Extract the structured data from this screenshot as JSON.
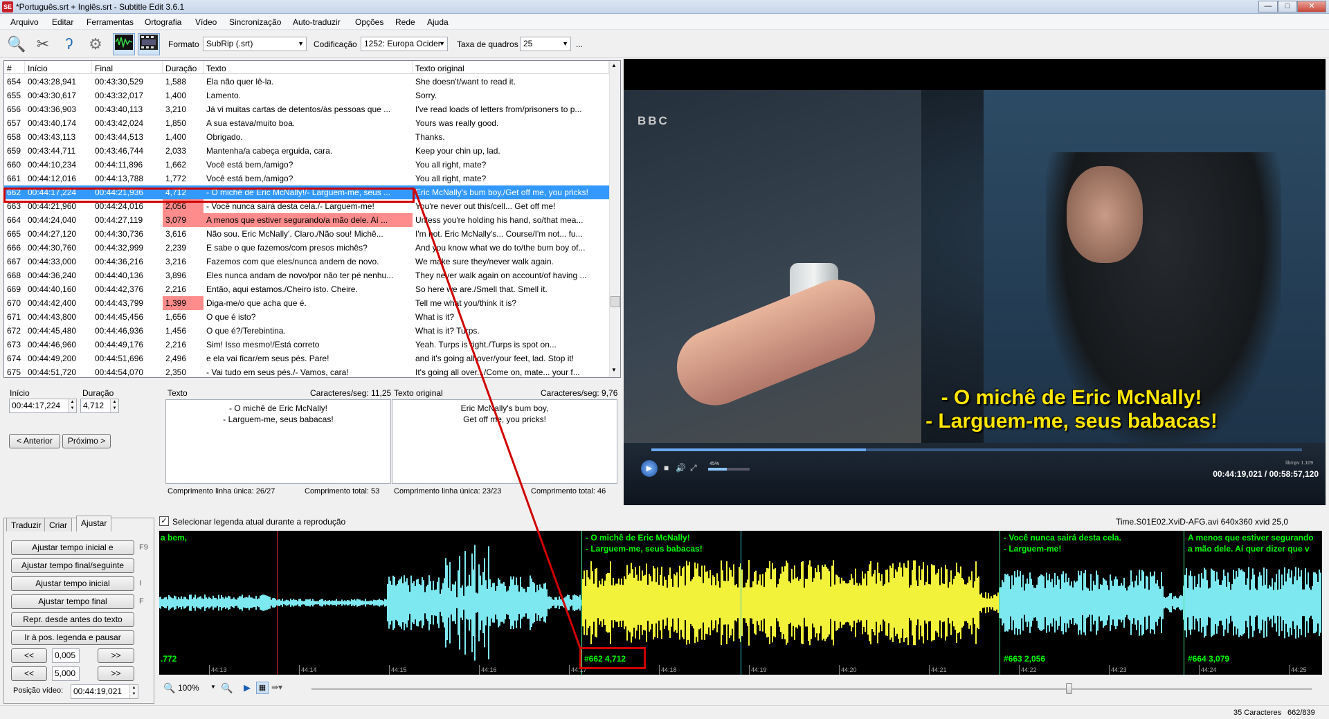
{
  "window": {
    "title": "*Português.srt + Inglês.srt - Subtitle Edit 3.6.1",
    "icon_label": "SE",
    "minimize": "—",
    "maximize": "□",
    "close": "✕"
  },
  "menu": [
    "Arquivo",
    "Editar",
    "Ferramentas",
    "Ortografia",
    "Vídeo",
    "Sincronização",
    "Auto-traduzir",
    "Opções",
    "Rede",
    "Ajuda"
  ],
  "toolbar": {
    "icons": [
      "search-replace-icon",
      "tools-icon",
      "spellcheck-icon",
      "settings-icon",
      "waveform-toggle-icon",
      "video-toggle-icon"
    ],
    "format_label": "Formato",
    "format_value": "SubRip (.srt)",
    "encoding_label": "Codificação",
    "encoding_value": "1252: Europa Ocider",
    "framerate_label": "Taxa de quadros",
    "framerate_value": "25",
    "more": "..."
  },
  "grid": {
    "headers": [
      "#",
      "Início",
      "Final",
      "Duração",
      "Texto",
      "Texto original"
    ],
    "selected_index": 8,
    "rows": [
      [
        "654",
        "00:43:28,941",
        "00:43:30,529",
        "1,588",
        "Ela não quer lê-la.",
        "She doesn't/want to read it."
      ],
      [
        "655",
        "00:43:30,617",
        "00:43:32,017",
        "1,400",
        "Lamento.",
        "Sorry."
      ],
      [
        "656",
        "00:43:36,903",
        "00:43:40,113",
        "3,210",
        "Já vi muitas cartas de detentos/às pessoas que ...",
        "I've read loads of letters from/prisoners to p..."
      ],
      [
        "657",
        "00:43:40,174",
        "00:43:42,024",
        "1,850",
        "A sua estava/muito boa.",
        "Yours was really good."
      ],
      [
        "658",
        "00:43:43,113",
        "00:43:44,513",
        "1,400",
        "Obrigado.",
        "Thanks."
      ],
      [
        "659",
        "00:43:44,711",
        "00:43:46,744",
        "2,033",
        "Mantenha/a cabeça erguida, cara.",
        "Keep your chin up, lad."
      ],
      [
        "660",
        "00:44:10,234",
        "00:44:11,896",
        "1,662",
        "Você está bem,/amigo?",
        "You all right, mate?"
      ],
      [
        "661",
        "00:44:12,016",
        "00:44:13,788",
        "1,772",
        "Você está bem,/amigo?",
        "You all right, mate?"
      ],
      [
        "662",
        "00:44:17,224",
        "00:44:21,936",
        "4,712",
        "- O michê de Eric McNally!/- Larguem-me, seus ...",
        "Eric McNally's bum boy,/Get off me, you pricks!"
      ],
      [
        "663",
        "00:44:21,960",
        "00:44:24,016",
        "2,056",
        "- Você nunca sairá desta cela./- Larguem-me!",
        "You're never out this/cell... Get off me!"
      ],
      [
        "664",
        "00:44:24,040",
        "00:44:27,119",
        "3,079",
        "A menos que estiver segurando/a mão dele. Aí ...",
        "Unless you're holding his hand, so/that mea..."
      ],
      [
        "665",
        "00:44:27,120",
        "00:44:30,736",
        "3,616",
        "Não sou. Eric McNally'. Claro./Não sou! Michê...",
        "I'm not. Eric McNally's... Course/I'm not... fu..."
      ],
      [
        "666",
        "00:44:30,760",
        "00:44:32,999",
        "2,239",
        "E sabe o que fazemos/com presos michês?",
        "And you know what we do to/the bum boy of..."
      ],
      [
        "667",
        "00:44:33,000",
        "00:44:36,216",
        "3,216",
        "Fazemos com que eles/nunca andem de novo.",
        "We make sure they/never walk again."
      ],
      [
        "668",
        "00:44:36,240",
        "00:44:40,136",
        "3,896",
        "Eles nunca andam de novo/por não ter pé nenhu...",
        "They never walk again on account/of having ..."
      ],
      [
        "669",
        "00:44:40,160",
        "00:44:42,376",
        "2,216",
        "Então, aqui estamos./Cheiro isto. Cheire.",
        "So here we are./Smell that. Smell it."
      ],
      [
        "670",
        "00:44:42,400",
        "00:44:43,799",
        "1,399",
        "Diga-me/o que acha que é.",
        "Tell me what you/think it is?"
      ],
      [
        "671",
        "00:44:43,800",
        "00:44:45,456",
        "1,656",
        "O que é isto?",
        "What is it?"
      ],
      [
        "672",
        "00:44:45,480",
        "00:44:46,936",
        "1,456",
        "O que é?/Terebintina.",
        "What is it? Turps."
      ],
      [
        "673",
        "00:44:46,960",
        "00:44:49,176",
        "2,216",
        "Sim! Isso mesmo!/Está correto",
        "Yeah. Turps is right./Turps is spot on..."
      ],
      [
        "674",
        "00:44:49,200",
        "00:44:51,696",
        "2,496",
        "e ela vai ficar/em seus pés. Pare!",
        "and it's going all over/your feet, lad. Stop it!"
      ],
      [
        "675",
        "00:44:51,720",
        "00:44:54,070",
        "2,350",
        "- Vai tudo em seus pés./- Vamos, cara!",
        "It's going all over.../Come on, mate... your f..."
      ]
    ],
    "pink_duration_rows": [
      9,
      10,
      16
    ],
    "pink_text_rows": [
      10
    ]
  },
  "editor": {
    "start_label": "Início",
    "start_value": "00:44:17,224",
    "duration_label": "Duração",
    "duration_value": "4,712",
    "prev_button": "< Anterior",
    "next_button": "Próximo >",
    "text_label": "Texto",
    "text_cps": "Caracteres/seg: 11,25",
    "text_value": "- O michê de Eric McNally!\n- Larguem-me, seus babacas!",
    "text_single_len": "Comprimento linha única: 26/27",
    "text_total_len": "Comprimento total: 53",
    "orig_label": "Texto original",
    "orig_cps": "Caracteres/seg: 9,76",
    "orig_value": "Eric McNally's bum boy,\nGet off me, you pricks!",
    "orig_single_len": "Comprimento linha única: 23/23",
    "orig_total_len": "Comprimento total: 46"
  },
  "video": {
    "channel_logo": "BBC",
    "subtitle_line1": "- O michê de Eric McNally!",
    "subtitle_line2": "- Larguem-me, seus babacas!",
    "progress": 0.33,
    "volume": 0.45,
    "volume_label": "45%",
    "lib_label": "libmpv 1.109",
    "time": "00:44:19,021 / 00:58:57,120"
  },
  "tabs": {
    "items": [
      "Traduzir",
      "Criar",
      "Ajustar"
    ],
    "active": 2
  },
  "adjust": {
    "buttons": [
      "Ajustar tempo inicial e",
      "Ajustar tempo final/seguinte",
      "Ajustar tempo inicial",
      "Ajustar tempo final",
      "Repr. desde antes do texto",
      "Ir à pos. legenda e pausar"
    ],
    "shortcuts": [
      "F9",
      "",
      "I",
      "F",
      "",
      ""
    ],
    "step1": "0,005",
    "step2": "5,000",
    "back": "<<",
    "fwd": ">>",
    "video_pos_label": "Posição vídeo:",
    "video_pos_value": "00:44:19,021"
  },
  "waveform": {
    "select_current_label": "Selecionar legenda atual durante a reprodução",
    "file_info": "Time.S01E02.XviD-AFG.avi 640x360 xvid 25,0",
    "zoom": "100%",
    "segments": [
      {
        "text": "a bem,",
        "num": ".772",
        "color": "#7ee8f0"
      },
      {
        "text": "- O michê de Eric McNally!\n- Larguem-me, seus babacas!",
        "num": "#662  4,712",
        "color": "#f2f23a"
      },
      {
        "text": "- Você nunca sairá desta cela.\n- Larguem-me!",
        "num": "#663  2,056",
        "color": "#7ee8f0"
      },
      {
        "text": "A menos que estiver segurando\na mão dele. Aí quer dizer que v",
        "num": "#664  3,079",
        "color": "#7ee8f0"
      }
    ],
    "ticks": [
      "44:13",
      "44:14",
      "44:15",
      "44:16",
      "44:17",
      "44:18",
      "44:19",
      "44:20",
      "44:21",
      "44:22",
      "44:23",
      "44:24",
      "44:25"
    ]
  },
  "status": {
    "chars": "35 Caracteres",
    "position": "662/839"
  }
}
